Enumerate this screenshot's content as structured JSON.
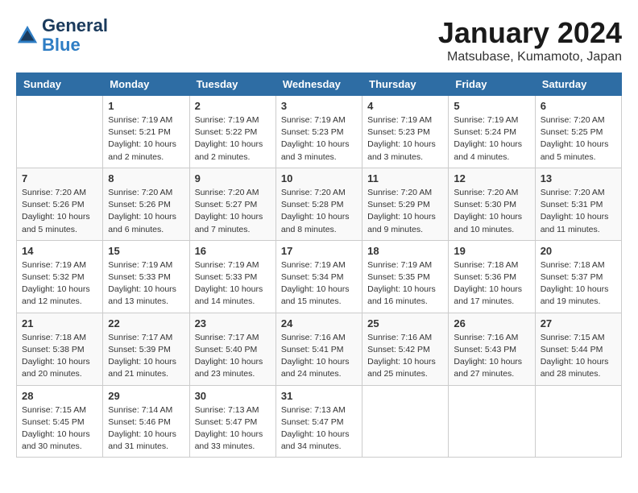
{
  "header": {
    "logo_general": "General",
    "logo_blue": "Blue",
    "month": "January 2024",
    "location": "Matsubase, Kumamoto, Japan"
  },
  "weekdays": [
    "Sunday",
    "Monday",
    "Tuesday",
    "Wednesday",
    "Thursday",
    "Friday",
    "Saturday"
  ],
  "weeks": [
    [
      {
        "day": "",
        "info": ""
      },
      {
        "day": "1",
        "info": "Sunrise: 7:19 AM\nSunset: 5:21 PM\nDaylight: 10 hours\nand 2 minutes."
      },
      {
        "day": "2",
        "info": "Sunrise: 7:19 AM\nSunset: 5:22 PM\nDaylight: 10 hours\nand 2 minutes."
      },
      {
        "day": "3",
        "info": "Sunrise: 7:19 AM\nSunset: 5:23 PM\nDaylight: 10 hours\nand 3 minutes."
      },
      {
        "day": "4",
        "info": "Sunrise: 7:19 AM\nSunset: 5:23 PM\nDaylight: 10 hours\nand 3 minutes."
      },
      {
        "day": "5",
        "info": "Sunrise: 7:19 AM\nSunset: 5:24 PM\nDaylight: 10 hours\nand 4 minutes."
      },
      {
        "day": "6",
        "info": "Sunrise: 7:20 AM\nSunset: 5:25 PM\nDaylight: 10 hours\nand 5 minutes."
      }
    ],
    [
      {
        "day": "7",
        "info": "Sunrise: 7:20 AM\nSunset: 5:26 PM\nDaylight: 10 hours\nand 5 minutes."
      },
      {
        "day": "8",
        "info": "Sunrise: 7:20 AM\nSunset: 5:26 PM\nDaylight: 10 hours\nand 6 minutes."
      },
      {
        "day": "9",
        "info": "Sunrise: 7:20 AM\nSunset: 5:27 PM\nDaylight: 10 hours\nand 7 minutes."
      },
      {
        "day": "10",
        "info": "Sunrise: 7:20 AM\nSunset: 5:28 PM\nDaylight: 10 hours\nand 8 minutes."
      },
      {
        "day": "11",
        "info": "Sunrise: 7:20 AM\nSunset: 5:29 PM\nDaylight: 10 hours\nand 9 minutes."
      },
      {
        "day": "12",
        "info": "Sunrise: 7:20 AM\nSunset: 5:30 PM\nDaylight: 10 hours\nand 10 minutes."
      },
      {
        "day": "13",
        "info": "Sunrise: 7:20 AM\nSunset: 5:31 PM\nDaylight: 10 hours\nand 11 minutes."
      }
    ],
    [
      {
        "day": "14",
        "info": "Sunrise: 7:19 AM\nSunset: 5:32 PM\nDaylight: 10 hours\nand 12 minutes."
      },
      {
        "day": "15",
        "info": "Sunrise: 7:19 AM\nSunset: 5:33 PM\nDaylight: 10 hours\nand 13 minutes."
      },
      {
        "day": "16",
        "info": "Sunrise: 7:19 AM\nSunset: 5:33 PM\nDaylight: 10 hours\nand 14 minutes."
      },
      {
        "day": "17",
        "info": "Sunrise: 7:19 AM\nSunset: 5:34 PM\nDaylight: 10 hours\nand 15 minutes."
      },
      {
        "day": "18",
        "info": "Sunrise: 7:19 AM\nSunset: 5:35 PM\nDaylight: 10 hours\nand 16 minutes."
      },
      {
        "day": "19",
        "info": "Sunrise: 7:18 AM\nSunset: 5:36 PM\nDaylight: 10 hours\nand 17 minutes."
      },
      {
        "day": "20",
        "info": "Sunrise: 7:18 AM\nSunset: 5:37 PM\nDaylight: 10 hours\nand 19 minutes."
      }
    ],
    [
      {
        "day": "21",
        "info": "Sunrise: 7:18 AM\nSunset: 5:38 PM\nDaylight: 10 hours\nand 20 minutes."
      },
      {
        "day": "22",
        "info": "Sunrise: 7:17 AM\nSunset: 5:39 PM\nDaylight: 10 hours\nand 21 minutes."
      },
      {
        "day": "23",
        "info": "Sunrise: 7:17 AM\nSunset: 5:40 PM\nDaylight: 10 hours\nand 23 minutes."
      },
      {
        "day": "24",
        "info": "Sunrise: 7:16 AM\nSunset: 5:41 PM\nDaylight: 10 hours\nand 24 minutes."
      },
      {
        "day": "25",
        "info": "Sunrise: 7:16 AM\nSunset: 5:42 PM\nDaylight: 10 hours\nand 25 minutes."
      },
      {
        "day": "26",
        "info": "Sunrise: 7:16 AM\nSunset: 5:43 PM\nDaylight: 10 hours\nand 27 minutes."
      },
      {
        "day": "27",
        "info": "Sunrise: 7:15 AM\nSunset: 5:44 PM\nDaylight: 10 hours\nand 28 minutes."
      }
    ],
    [
      {
        "day": "28",
        "info": "Sunrise: 7:15 AM\nSunset: 5:45 PM\nDaylight: 10 hours\nand 30 minutes."
      },
      {
        "day": "29",
        "info": "Sunrise: 7:14 AM\nSunset: 5:46 PM\nDaylight: 10 hours\nand 31 minutes."
      },
      {
        "day": "30",
        "info": "Sunrise: 7:13 AM\nSunset: 5:47 PM\nDaylight: 10 hours\nand 33 minutes."
      },
      {
        "day": "31",
        "info": "Sunrise: 7:13 AM\nSunset: 5:47 PM\nDaylight: 10 hours\nand 34 minutes."
      },
      {
        "day": "",
        "info": ""
      },
      {
        "day": "",
        "info": ""
      },
      {
        "day": "",
        "info": ""
      }
    ]
  ]
}
